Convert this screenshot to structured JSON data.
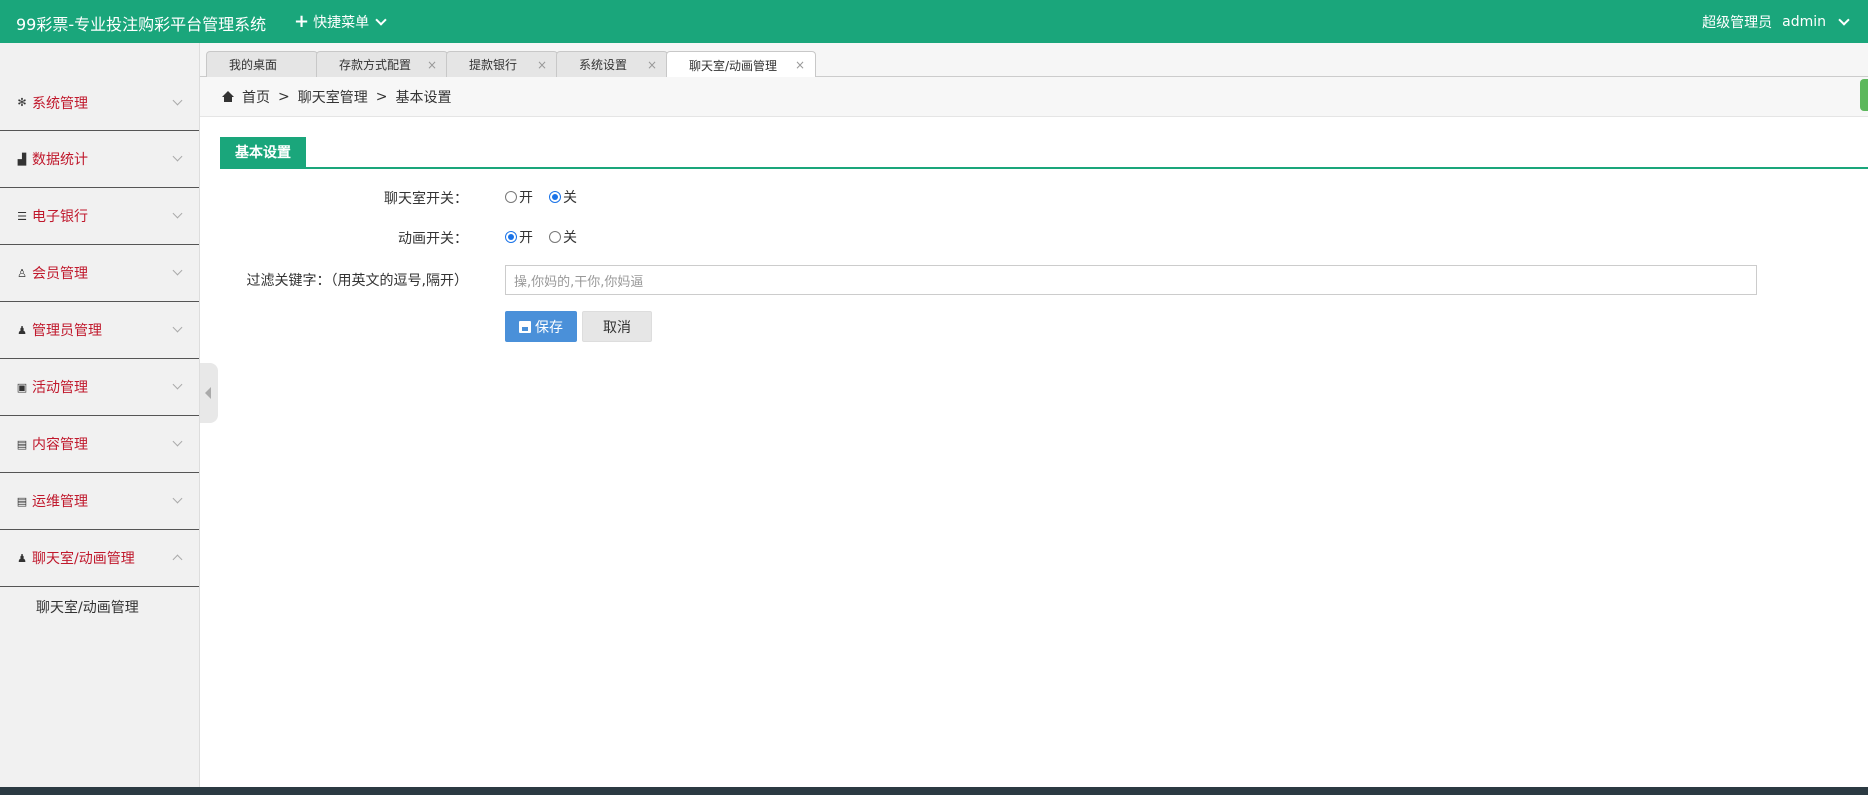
{
  "header": {
    "title": "99彩票-专业投注购彩平台管理系统",
    "quick_menu": "快捷菜单",
    "role": "超级管理员",
    "user": "admin"
  },
  "sidebar": {
    "items": [
      {
        "label": "系统管理",
        "icon": "gear-icon"
      },
      {
        "label": "数据统计",
        "icon": "bar-chart-icon"
      },
      {
        "label": "电子银行",
        "icon": "list-icon"
      },
      {
        "label": "会员管理",
        "icon": "user-icon"
      },
      {
        "label": "管理员管理",
        "icon": "user-icon"
      },
      {
        "label": "活动管理",
        "icon": "gift-icon"
      },
      {
        "label": "内容管理",
        "icon": "document-icon"
      },
      {
        "label": "运维管理",
        "icon": "document-icon"
      },
      {
        "label": "聊天室/动画管理",
        "icon": "user-icon"
      }
    ],
    "sub_items": [
      "聊天室/动画管理"
    ]
  },
  "tabs": [
    {
      "label": "我的桌面",
      "closable": false
    },
    {
      "label": "存款方式配置",
      "closable": true
    },
    {
      "label": "提款银行",
      "closable": true
    },
    {
      "label": "系统设置",
      "closable": true
    },
    {
      "label": "聊天室/动画管理",
      "closable": true,
      "active": true
    }
  ],
  "breadcrumb": {
    "home": "首页",
    "sep": ">",
    "level1": "聊天室管理",
    "level2": "基本设置"
  },
  "section": {
    "title": "基本设置"
  },
  "form": {
    "chat_label": "聊天室开关：",
    "chat_on": "开",
    "chat_off": "关",
    "chat_value": "off",
    "anim_label": "动画开关：",
    "anim_on": "开",
    "anim_off": "关",
    "anim_value": "on",
    "filter_label": "过滤关键字：（用英文的逗号,隔开）",
    "filter_value": "操,你妈的,干你,你妈逼",
    "save_label": "保存",
    "cancel_label": "取消"
  },
  "colors": {
    "brand": "#1aa67b",
    "menu_text": "#c0182c",
    "primary_button": "#4a90d9"
  }
}
